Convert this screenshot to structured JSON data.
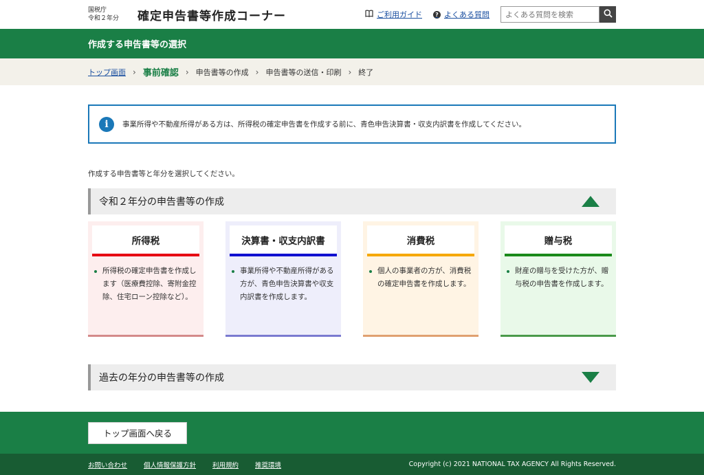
{
  "header": {
    "agency_line1": "国税庁",
    "agency_line2": "令和２年分",
    "site_title": "確定申告書等作成コーナー",
    "guide_link": "ご利用ガイド",
    "faq_link": "よくある質問",
    "search_placeholder": "よくある質問を検索",
    "icons": [
      "book-icon",
      "question-icon",
      "search-icon"
    ]
  },
  "band": {
    "title": "作成する申告書等の選択"
  },
  "breadcrumb": {
    "items": [
      "トップ画面",
      "事前確認",
      "申告書等の作成",
      "申告書等の送信・印刷",
      "終了"
    ],
    "separator": "›"
  },
  "notice": {
    "icon_glyph": "i",
    "text": "事業所得や不動産所得がある方は、所得税の確定申告書を作成する前に、青色申告決算書・収支内訳書を作成してください。"
  },
  "instruction": "作成する申告書等と年分を選択してください。",
  "current_section": {
    "title": "令和２年分の申告書等の作成",
    "cards": [
      {
        "title": "所得税",
        "description": "所得税の確定申告書を作成します（医療費控除、寄附金控除、住宅ローン控除など）。",
        "accent": "#e60012"
      },
      {
        "title": "決算書・収支内訳書",
        "description": "事業所得や不動産所得がある方が、青色申告決算書や収支内訳書を作成します。",
        "accent": "#1010d0"
      },
      {
        "title": "消費税",
        "description": "個人の事業者の方が、消費税の確定申告書を作成します。",
        "accent": "#f5a800"
      },
      {
        "title": "贈与税",
        "description": "財産の贈与を受けた方が、贈与税の申告書を作成します。",
        "accent": "#1a8a1a"
      }
    ]
  },
  "past_section": {
    "title": "過去の年分の申告書等の作成"
  },
  "footer": {
    "back_button": "トップ画面へ戻る",
    "links": [
      "お問い合わせ",
      "個人情報保護方針",
      "利用規約",
      "推奨環境"
    ],
    "copyright": "Copyright (c) 2021 NATIONAL TAX AGENCY All Rights Reserved."
  },
  "colors": {
    "brand_green": "#1a7f46",
    "notice_blue": "#1a78b8",
    "footer_dark": "#185c33"
  }
}
